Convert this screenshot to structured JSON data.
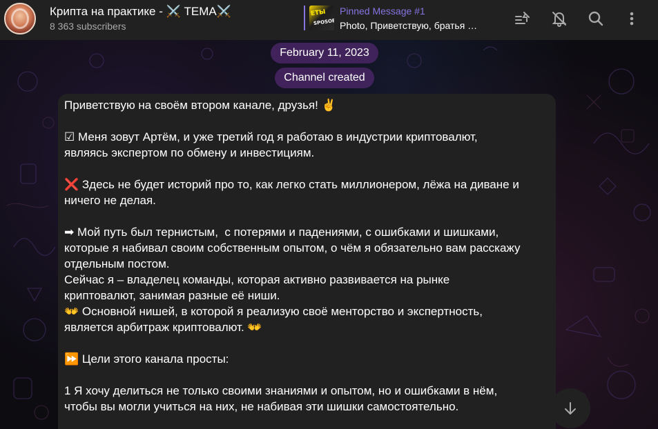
{
  "header": {
    "channel_title": "Крипта на практике - ⚔️ TEMA⚔️",
    "subscribers": "8 363 subscribers",
    "pinned": {
      "title": "Pinned Message #1",
      "preview": "Photo, Приветствую, братья …",
      "thumb_text_1": "ЕТЫ",
      "thumb_text_2": "SPOSOB"
    }
  },
  "icons": {
    "pinned_list": "pinned-messages-icon",
    "mute": "bell-muted-icon",
    "search": "search-icon",
    "menu": "more-vertical-icon",
    "scroll": "arrow-down-icon"
  },
  "service": {
    "date": "February 11, 2023",
    "created": "Channel created"
  },
  "message": {
    "lines": [
      "Приветствую на своём втором канале, друзья! ✌",
      "",
      "☑ Меня зовут Артём, и уже третий год я работаю в индустрии криптовалют,",
      "являясь экспертом по обмену и инвестициям.",
      "",
      "❌ Здесь не будет историй про то, как легко стать миллионером, лёжа на диване и",
      "ничего не делая.",
      "",
      "➡ Мой путь был тернистым,  с потерями и падениями, с ошибками и шишками,",
      "которые я набивал своим собственным опытом, о чём я обязательно вам расскажу",
      "отдельным постом.",
      "Сейчас я – владелец команды, которая активно развивается на рынке",
      "криптовалют, занимая разные её ниши.",
      "👐 Основной нишей, в которой я реализую своё менторство и экспертность,",
      "является арбитраж криптовалют. 👐",
      "",
      "⏩ Цели этого канала просты:",
      "",
      "1 Я хочу делиться не только своими знаниями и опытом, но и ошибками в нём,",
      "чтобы вы могли учиться на них, не набивая эти шишки самостоятельно."
    ]
  },
  "colors": {
    "accent": "#8774e1",
    "header_bg": "#212121",
    "bubble_bg": "#212121",
    "pill_bg": "#50286e"
  }
}
